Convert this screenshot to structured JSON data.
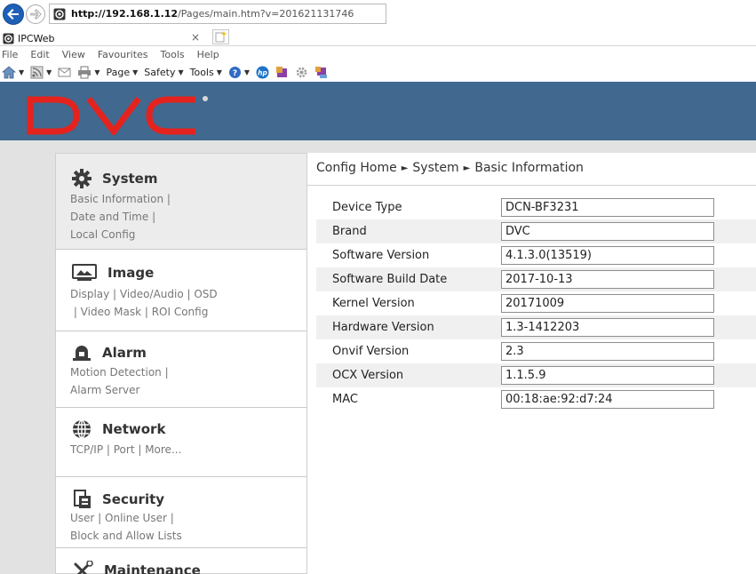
{
  "browser": {
    "url_host": "http://192.168.1.12",
    "url_path": "/Pages/main.htm?v=201621131746",
    "tab_title": "IPCWeb",
    "tab_close": "×",
    "menu": [
      "File",
      "Edit",
      "View",
      "Favourites",
      "Tools",
      "Help"
    ],
    "commands": {
      "page": "Page",
      "safety": "Safety",
      "tools": "Tools"
    }
  },
  "app": {
    "logo_text": "DVC",
    "logo_color": "#e4231e",
    "header_color": "#41688f"
  },
  "sidebar": {
    "sections": [
      {
        "title": "System",
        "icon": "gear-icon",
        "links": "Basic Information |\nDate and Time |\nLocal Config"
      },
      {
        "title": "Image",
        "icon": "monitor-icon",
        "links": "Display | Video/Audio | OSD\n | Video Mask | ROI Config"
      },
      {
        "title": "Alarm",
        "icon": "alarm-light-icon",
        "links": "Motion Detection |\nAlarm Server"
      },
      {
        "title": "Network",
        "icon": "globe-icon",
        "links": "TCP/IP | Port | More..."
      },
      {
        "title": "Security",
        "icon": "security-card-icon",
        "links": "User | Online User |\nBlock and Allow Lists"
      },
      {
        "title": "Maintenance",
        "icon": "tools-icon",
        "links": ""
      }
    ]
  },
  "breadcrumb": {
    "home": "Config Home",
    "section": "System",
    "page": "Basic Information",
    "separator": "►"
  },
  "device_info": [
    {
      "label": "Device Type",
      "value": "DCN-BF3231"
    },
    {
      "label": "Brand",
      "value": "DVC"
    },
    {
      "label": "Software Version",
      "value": "4.1.3.0(13519)"
    },
    {
      "label": "Software Build Date",
      "value": "2017-10-13"
    },
    {
      "label": "Kernel Version",
      "value": "20171009"
    },
    {
      "label": "Hardware Version",
      "value": "1.3-1412203"
    },
    {
      "label": "Onvif Version",
      "value": "2.3"
    },
    {
      "label": "OCX Version",
      "value": "1.1.5.9"
    },
    {
      "label": "MAC",
      "value": "00:18:ae:92:d7:24"
    }
  ]
}
